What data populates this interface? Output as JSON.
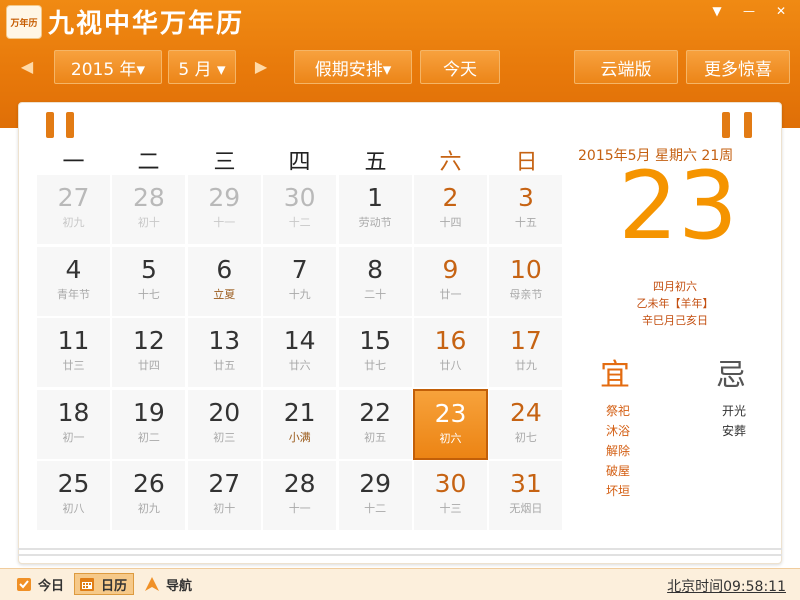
{
  "app": {
    "logo_text": "万年历",
    "title": "九视中华万年历",
    "window": {
      "menu_glyph": "▼",
      "minimize_glyph": "—",
      "close_glyph": "✕"
    }
  },
  "toolbar": {
    "prev_glyph": "◀",
    "next_glyph": "▶",
    "year_select": "2015 年▾",
    "month_select": "5 月 ▾",
    "holiday_button": "假期安排▾",
    "today_button": "今天",
    "cloud_button": "云端版",
    "more_button": "更多惊喜"
  },
  "weekdays": [
    "一",
    "二",
    "三",
    "四",
    "五",
    "六",
    "日"
  ],
  "calendar": {
    "rows": [
      [
        {
          "day": "27",
          "sub": "初九",
          "other": true
        },
        {
          "day": "28",
          "sub": "初十",
          "other": true
        },
        {
          "day": "29",
          "sub": "十一",
          "other": true
        },
        {
          "day": "30",
          "sub": "十二",
          "other": true
        },
        {
          "day": "1",
          "sub": "劳动节",
          "other": false
        },
        {
          "day": "2",
          "sub": "十四",
          "other": false
        },
        {
          "day": "3",
          "sub": "十五",
          "other": false
        }
      ],
      [
        {
          "day": "4",
          "sub": "青年节"
        },
        {
          "day": "5",
          "sub": "十七"
        },
        {
          "day": "6",
          "sub": "立夏",
          "term": true
        },
        {
          "day": "7",
          "sub": "十九"
        },
        {
          "day": "8",
          "sub": "二十"
        },
        {
          "day": "9",
          "sub": "廿一"
        },
        {
          "day": "10",
          "sub": "母亲节"
        }
      ],
      [
        {
          "day": "11",
          "sub": "廿三"
        },
        {
          "day": "12",
          "sub": "廿四"
        },
        {
          "day": "13",
          "sub": "廿五"
        },
        {
          "day": "14",
          "sub": "廿六"
        },
        {
          "day": "15",
          "sub": "廿七"
        },
        {
          "day": "16",
          "sub": "廿八"
        },
        {
          "day": "17",
          "sub": "廿九"
        }
      ],
      [
        {
          "day": "18",
          "sub": "初一"
        },
        {
          "day": "19",
          "sub": "初二"
        },
        {
          "day": "20",
          "sub": "初三"
        },
        {
          "day": "21",
          "sub": "小满",
          "term": true
        },
        {
          "day": "22",
          "sub": "初五"
        },
        {
          "day": "23",
          "sub": "初六",
          "today": true
        },
        {
          "day": "24",
          "sub": "初七"
        }
      ],
      [
        {
          "day": "25",
          "sub": "初八"
        },
        {
          "day": "26",
          "sub": "初九"
        },
        {
          "day": "27",
          "sub": "初十"
        },
        {
          "day": "28",
          "sub": "十一"
        },
        {
          "day": "29",
          "sub": "十二"
        },
        {
          "day": "30",
          "sub": "十三"
        },
        {
          "day": "31",
          "sub": "无烟日"
        }
      ]
    ]
  },
  "detail": {
    "date_line": "2015年5月   星期六   21周",
    "big_day": "23",
    "lunar_date": "四月初六",
    "ganzhi_year": "乙未年【羊年】",
    "ganzhi_month_day": "辛巳月己亥日",
    "yi_label": "宜",
    "ji_label": "忌",
    "yi_items": [
      "祭祀",
      "沐浴",
      "解除",
      "破屋",
      "坏垣"
    ],
    "ji_items": [
      "开光",
      "安葬"
    ]
  },
  "statusbar": {
    "today_label": "今日",
    "calendar_label": "日历",
    "nav_label": "导航",
    "clock": "北京时间09:58:11"
  },
  "colors": {
    "brand": "#ec8414",
    "accent_text": "#c66313",
    "big_day": "#f59400"
  }
}
